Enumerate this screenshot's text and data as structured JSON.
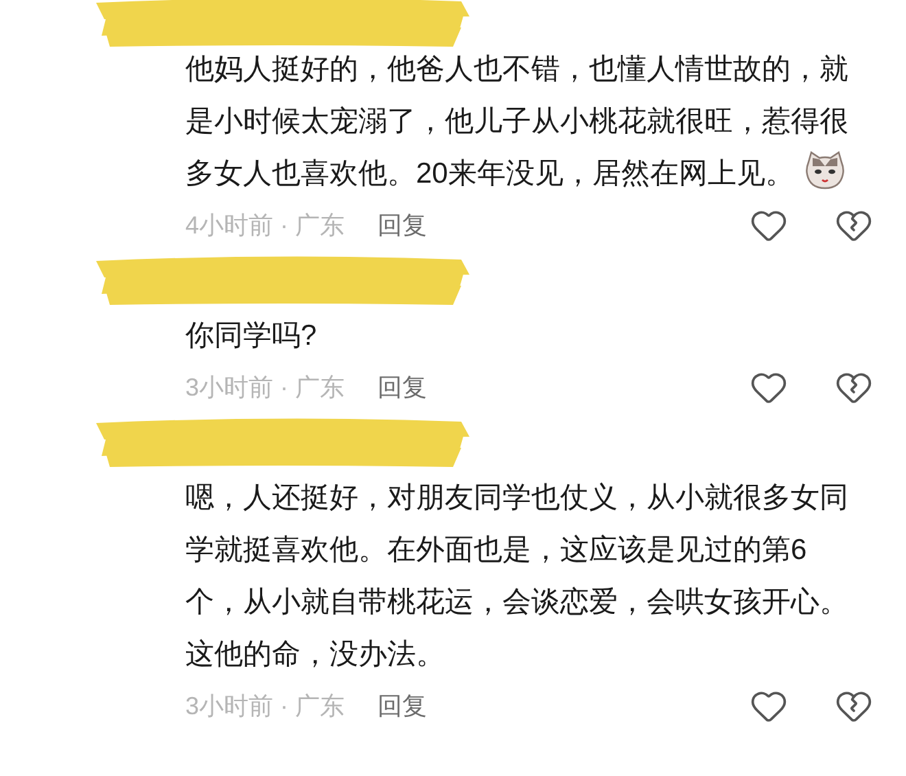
{
  "comments": [
    {
      "text": "他妈人挺好的，他爸人也不错，也懂人情世故的，就是小时候太宠溺了，他儿子从小桃花就很旺，惹得很多女人也喜欢他。20来年没见，居然在网上见。",
      "sticker": true,
      "meta": "4小时前 · 广东",
      "reply": "回复"
    },
    {
      "text": "你同学吗?",
      "sticker": false,
      "meta": "3小时前 · 广东",
      "reply": "回复"
    },
    {
      "text": "嗯，人还挺好，对朋友同学也仗义，从小就很多女同学就挺喜欢他。在外面也是，这应该是见过的第6个，从小就自带桃花运，会谈恋爱，会哄女孩开心。这他的命，没办法。",
      "sticker": false,
      "meta": "3小时前 · 广东",
      "reply": "回复"
    }
  ]
}
